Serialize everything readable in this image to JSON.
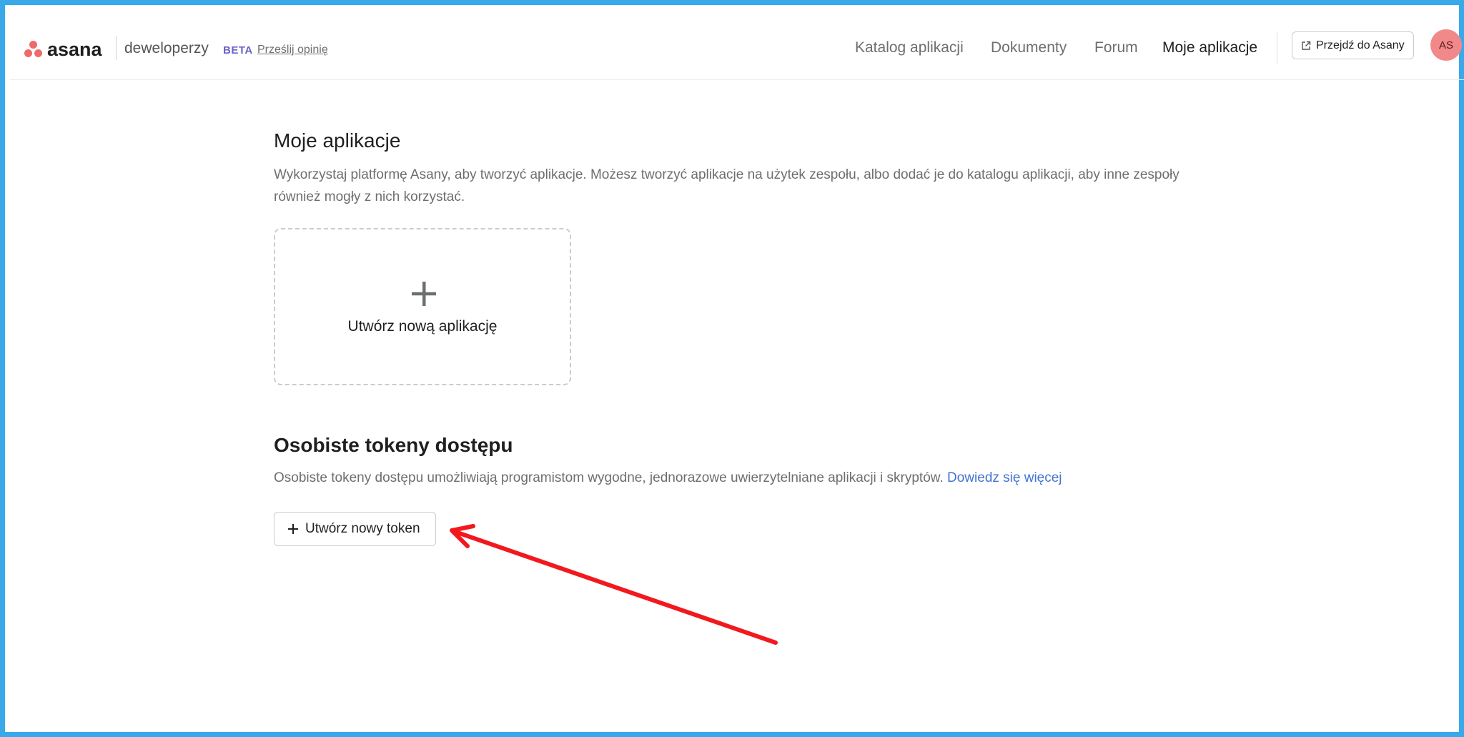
{
  "header": {
    "logo_text": "asana",
    "brand_sub": "deweloperzy",
    "beta_label": "BETA",
    "feedback_link": "Prześlij opinię",
    "nav": {
      "catalog": "Katalog aplikacji",
      "docs": "Dokumenty",
      "forum": "Forum",
      "my_apps": "Moje aplikacje"
    },
    "go_to_asana": "Przejdź do Asany",
    "avatar_initials": "AS"
  },
  "apps_section": {
    "title": "Moje aplikacje",
    "description_line1": "Wykorzystaj platformę Asany, aby tworzyć aplikacje. Możesz tworzyć aplikacje na użytek zespołu, albo dodać je do katalogu aplikacji, aby inne zespoły",
    "description_line2": "również mogły z nich korzystać.",
    "create_app_label": "Utwórz nową aplikację"
  },
  "tokens_section": {
    "title": "Osobiste tokeny dostępu",
    "description": "Osobiste tokeny dostępu umożliwiają programistom wygodne, jednorazowe uwierzytelniane aplikacji i skryptów.",
    "learn_more": "Dowiedz się więcej",
    "create_token_label": "Utwórz nowy token"
  },
  "colors": {
    "frame_border": "#3aa9ea",
    "brand_coral": "#f06a6a",
    "link_blue": "#4573d2",
    "beta_purple": "#6a62c9",
    "annotation_arrow": "#f2191e"
  }
}
